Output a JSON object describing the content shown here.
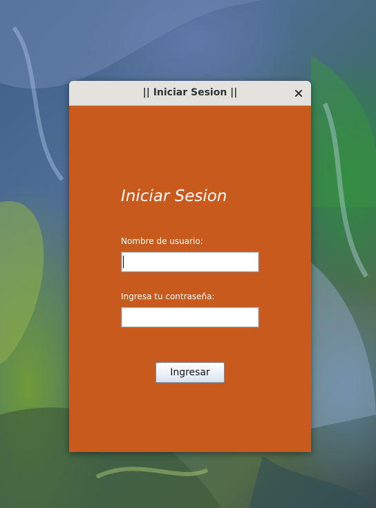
{
  "window": {
    "title": "|| Iniciar Sesion ||"
  },
  "form": {
    "heading": "Iniciar Sesion",
    "username_label": "Nombre de usuario:",
    "username_value": "",
    "password_label": "Ingresa tu contraseña:",
    "password_value": "",
    "submit_label": "Ingresar"
  },
  "icons": {
    "close": "close-icon"
  },
  "colors": {
    "panel_background": "#c85a1d",
    "titlebar_background": "#e3e2df",
    "text_on_panel": "#ffffff"
  }
}
